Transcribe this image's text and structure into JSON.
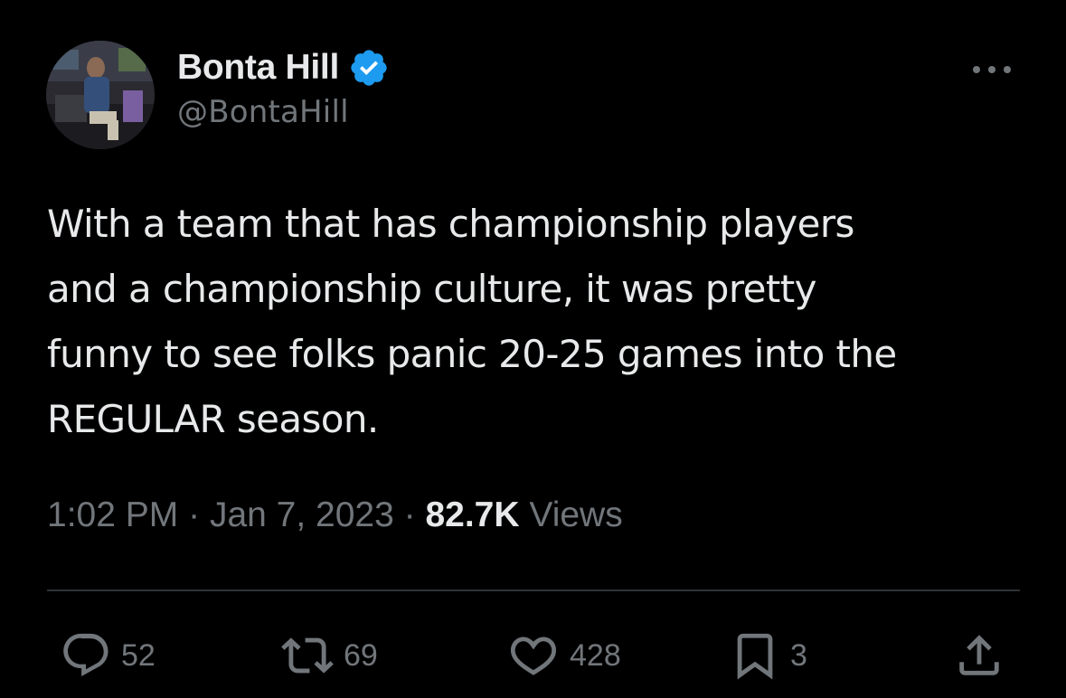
{
  "author": {
    "display_name": "Bonta Hill",
    "handle": "@BontaHill",
    "verified_icon": "verified-badge-icon",
    "verified_color": "#1d9bf0"
  },
  "tweet": {
    "text": "With a team that has championship players\nand a championship culture, it was pretty\nfunny to see folks panic 20-25 games into the\nREGULAR season."
  },
  "meta": {
    "time": "1:02 PM",
    "separator": "·",
    "date": "Jan 7, 2023",
    "views_count": "82.7K",
    "views_label": "Views"
  },
  "actions": {
    "reply": {
      "icon": "reply-icon",
      "count": "52"
    },
    "retweet": {
      "icon": "retweet-icon",
      "count": "69"
    },
    "like": {
      "icon": "heart-icon",
      "count": "428"
    },
    "bookmark": {
      "icon": "bookmark-icon",
      "count": "3"
    },
    "share": {
      "icon": "share-icon"
    }
  },
  "more_menu": {
    "icon": "more-options-icon"
  },
  "colors": {
    "background": "#000000",
    "primary_text": "#e7e9ea",
    "secondary_text": "#71767b",
    "divider": "#2f3336"
  }
}
